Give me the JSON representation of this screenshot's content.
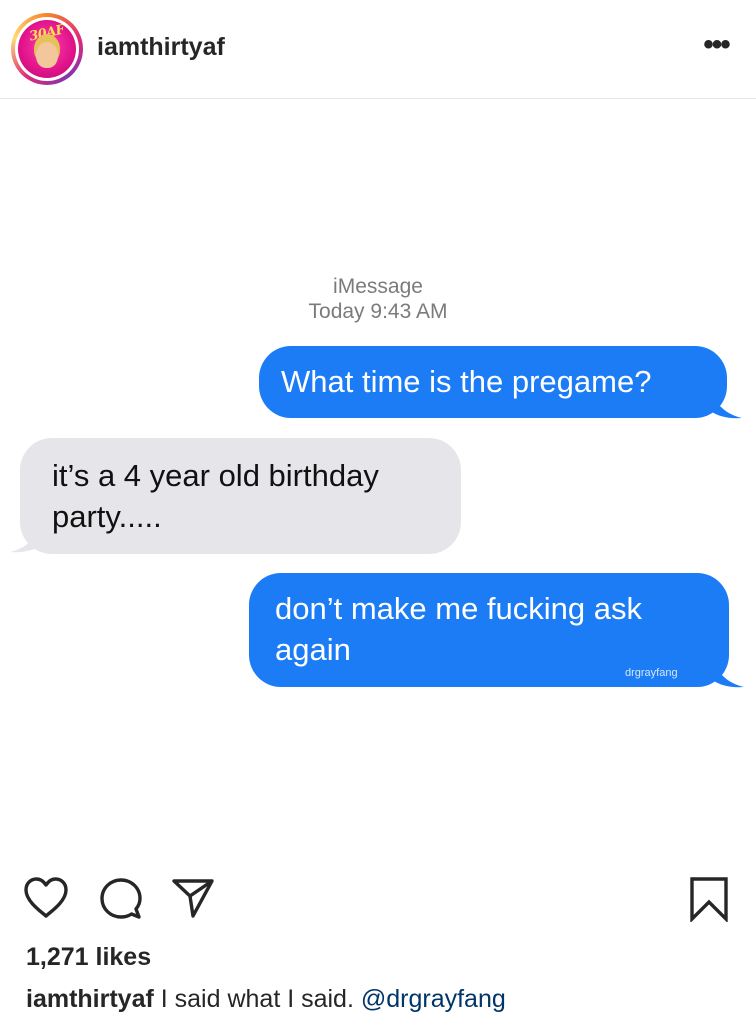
{
  "header": {
    "username": "iamthirtyaf",
    "avatar_logo_text": "30AF",
    "more_label": "•••"
  },
  "post": {
    "imessage_label": "iMessage",
    "timestamp_day": "Today",
    "timestamp_time": "9:43 AM",
    "messages": [
      {
        "direction": "sent",
        "text": "What time is the pregame?"
      },
      {
        "direction": "received",
        "line1": "it’s a 4 year old birthday",
        "line2": "party....."
      },
      {
        "direction": "sent",
        "line1": "don’t make me fucking ask",
        "line2": "again"
      }
    ],
    "watermark": "drgrayfang",
    "colors": {
      "sent_bubble": "#1b7cf5",
      "received_bubble": "#e6e5ea"
    }
  },
  "actions": {
    "like_icon": "heart-icon",
    "comment_icon": "comment-icon",
    "share_icon": "share-icon",
    "save_icon": "bookmark-icon"
  },
  "likes": "1,271 likes",
  "caption": {
    "username": "iamthirtyaf",
    "text": " I said what I said. ",
    "mention": "@drgrayfang"
  }
}
